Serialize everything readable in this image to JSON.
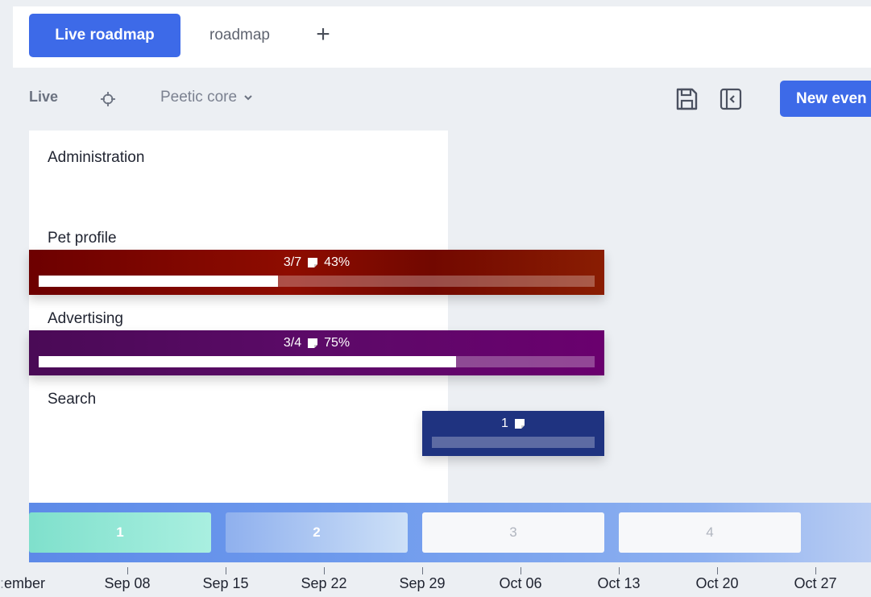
{
  "tabs": {
    "active": "Live roadmap",
    "other": "roadmap",
    "add_symbol": "+"
  },
  "toolbar": {
    "mode": "Live",
    "project": "Peetic core",
    "new_event": "New even"
  },
  "groups": [
    {
      "label": "Administration"
    },
    {
      "label": "Pet profile",
      "progress_text": "3/7",
      "percent_text": "43%",
      "progress": 0.43,
      "color": "#7f0a00"
    },
    {
      "label": "Advertising",
      "progress_text": "3/4",
      "percent_text": "75%",
      "progress": 0.75,
      "color": "#5a0a66"
    },
    {
      "label": "Search",
      "progress_text": "1",
      "progress": 0,
      "color": "#1f3380"
    }
  ],
  "sprints": [
    "1",
    "2",
    "3",
    "4"
  ],
  "timeline": {
    "first_label": "ember",
    "dates": [
      "Sep 08",
      "Sep 15",
      "Sep 22",
      "Sep 29",
      "Oct 06",
      "Oct 13",
      "Oct 20",
      "Oct 27"
    ]
  },
  "colors": {
    "accent": "#3d6ae8"
  }
}
